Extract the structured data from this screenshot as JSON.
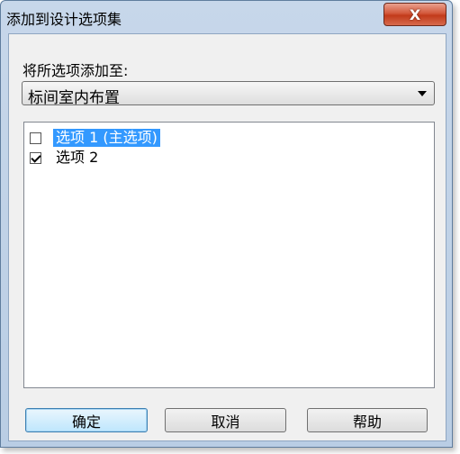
{
  "window": {
    "title": "添加到设计选项集",
    "close_glyph": "X"
  },
  "form": {
    "add_to_label": "将所选项添加至:",
    "option_set_select": {
      "selected": "标间室内布置"
    }
  },
  "options": [
    {
      "label": "选项 1 (主选项)",
      "checked": false,
      "selected": true
    },
    {
      "label": "选项 2",
      "checked": true,
      "selected": false
    }
  ],
  "buttons": {
    "ok": "确定",
    "cancel": "取消",
    "help": "帮助"
  }
}
